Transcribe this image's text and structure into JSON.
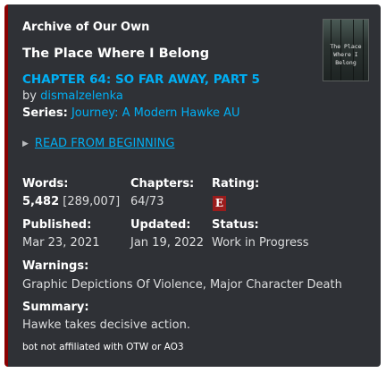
{
  "site": "Archive of Our Own",
  "work": {
    "title": "The Place Where I Belong",
    "chapter_title": "CHAPTER 64: SO FAR AWAY, PART 5",
    "by_prefix": "by ",
    "author": "dismalzelenka",
    "series_label": "Series:",
    "series_name": "Journey: A Modern Hawke AU",
    "read_link": "READ FROM BEGINNING"
  },
  "stats": {
    "words_label": "Words:",
    "words_value": "5,482",
    "words_total": "[289,007]",
    "chapters_label": "Chapters:",
    "chapters_value": "64/73",
    "rating_label": "Rating:",
    "rating_value": "E",
    "published_label": "Published:",
    "published_value": "Mar 23, 2021",
    "updated_label": "Updated:",
    "updated_value": "Jan 19, 2022",
    "status_label": "Status:",
    "status_value": "Work in Progress"
  },
  "warnings_label": "Warnings:",
  "warnings_value": "Graphic Depictions Of Violence, Major Character Death",
  "summary_label": "Summary:",
  "summary_value": "Hawke takes decisive action.",
  "footer": "bot not affiliated with OTW or AO3",
  "thumbnail": {
    "line1": "The Place",
    "line2": "Where I",
    "line3": "Belong"
  },
  "colors": {
    "accent_bar": "#8b0000",
    "link": "#00aff4",
    "rating_badge": "#9a1c1c",
    "background": "#2f3136"
  }
}
